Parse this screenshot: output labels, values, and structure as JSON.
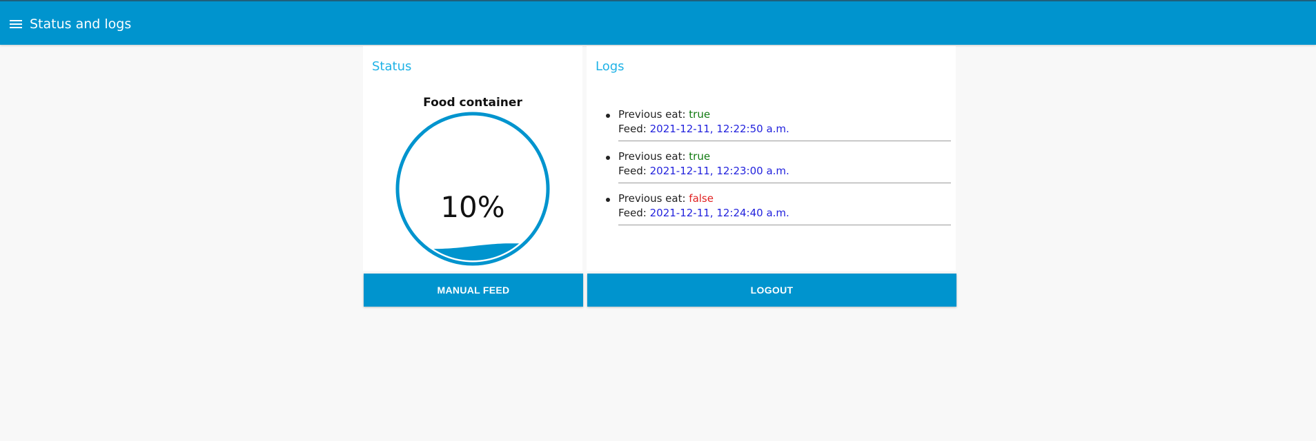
{
  "header": {
    "title": "Status and logs",
    "menu_icon": "hamburger-menu-icon",
    "color": "#0094ce"
  },
  "status": {
    "title": "Status",
    "gauge_label": "Food container",
    "level_percent": 10,
    "level_text": "10%",
    "gauge_color": "#0094ce",
    "button_label": "MANUAL FEED"
  },
  "logs": {
    "title": "Logs",
    "eat_label": "Previous eat:",
    "feed_label": "Feed:",
    "entries": [
      {
        "previous_eat": "true",
        "feed": "2021-12-11, 12:22:50 a.m."
      },
      {
        "previous_eat": "true",
        "feed": "2021-12-11, 12:23:00 a.m."
      },
      {
        "previous_eat": "false",
        "feed": "2021-12-11, 12:24:40 a.m."
      }
    ],
    "true_color": "#107a10",
    "false_color": "#e02020",
    "date_color": "#2222dd",
    "button_label": "LOGOUT"
  }
}
